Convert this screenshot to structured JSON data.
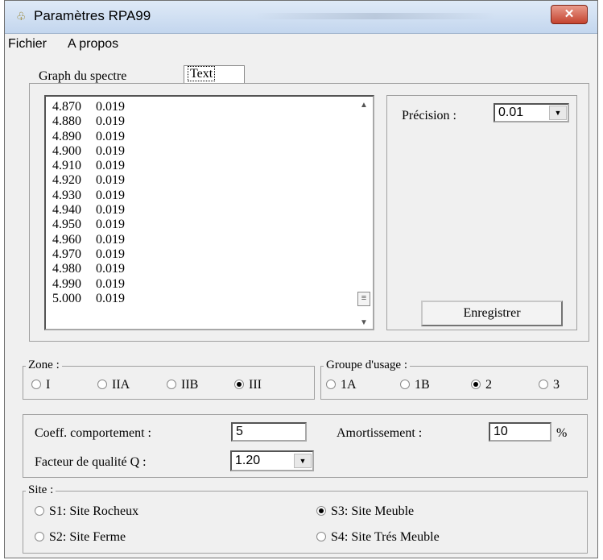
{
  "window": {
    "title": "Paramètres RPA99",
    "close_glyph": "✕",
    "app_icon_glyph": "♧"
  },
  "menu": {
    "items": [
      "Fichier",
      "A propos"
    ]
  },
  "tabs": {
    "items": [
      "Graph du spectre",
      "Text"
    ],
    "active": "Text"
  },
  "spectrum_list": {
    "rows": [
      [
        "4.870",
        "0.019"
      ],
      [
        "4.880",
        "0.019"
      ],
      [
        "4.890",
        "0.019"
      ],
      [
        "4.900",
        "0.019"
      ],
      [
        "4.910",
        "0.019"
      ],
      [
        "4.920",
        "0.019"
      ],
      [
        "4.930",
        "0.019"
      ],
      [
        "4.940",
        "0.019"
      ],
      [
        "4.950",
        "0.019"
      ],
      [
        "4.960",
        "0.019"
      ],
      [
        "4.970",
        "0.019"
      ],
      [
        "4.980",
        "0.019"
      ],
      [
        "4.990",
        "0.019"
      ],
      [
        "5.000",
        "0.019"
      ]
    ],
    "scroll_up_glyph": "▲",
    "scroll_down_glyph": "▼",
    "thumb_glyph": "≡"
  },
  "precision": {
    "label": "Précision :",
    "value": "0.01",
    "arrow_glyph": "▼"
  },
  "save_button": {
    "label": "Enregistrer"
  },
  "zone": {
    "legend": "Zone :",
    "options": [
      "I",
      "IIA",
      "IIB",
      "III"
    ],
    "selected": "III"
  },
  "groupe_usage": {
    "legend": "Groupe d'usage :",
    "options": [
      "1A",
      "1B",
      "2",
      "3"
    ],
    "selected": "2"
  },
  "parameters": {
    "coeff_label": "Coeff. comportement :",
    "coeff_value": "5",
    "amort_label": "Amortissement :",
    "amort_value": "10",
    "amort_unit": "%",
    "qualite_label": "Facteur de qualité Q :",
    "qualite_value": "1.20",
    "arrow_glyph": "▼"
  },
  "site": {
    "legend": "Site :",
    "options": [
      "S1: Site Rocheux",
      "S3: Site Meuble",
      "S2: Site Ferme",
      "S4: Site Trés Meuble"
    ],
    "selected": "S3: Site Meuble"
  }
}
